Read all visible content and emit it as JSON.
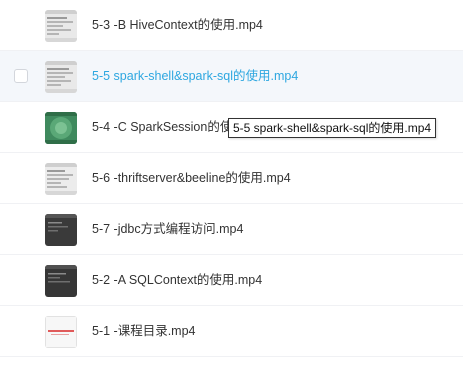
{
  "files": [
    {
      "name": "5-3 -B HiveContext的使用.mp4",
      "thumb": "light-screenshot-icon",
      "hover": false
    },
    {
      "name": "5-5 spark-shell&spark-sql的使用.mp4",
      "thumb": "light-screenshot-icon",
      "hover": true
    },
    {
      "name": "5-4 -C SparkSession的使用.mp4",
      "thumb": "green-slide-icon",
      "hover": false
    },
    {
      "name": "5-6 -thriftserver&beeline的使用.mp4",
      "thumb": "light-screenshot-icon",
      "hover": false
    },
    {
      "name": "5-7 -jdbc方式编程访问.mp4",
      "thumb": "dark-terminal-icon",
      "hover": false
    },
    {
      "name": "5-2 -A SQLContext的使用.mp4",
      "thumb": "dark-terminal-icon",
      "hover": false
    },
    {
      "name": "5-1 -课程目录.mp4",
      "thumb": "red-text-slide-icon",
      "hover": false
    }
  ],
  "tooltip": {
    "text": "5-5 spark-shell&spark-sql的使用.mp4"
  },
  "colors": {
    "hover_text": "#2ea7e0",
    "hover_bg": "#f4f7fb",
    "text": "#333333"
  }
}
